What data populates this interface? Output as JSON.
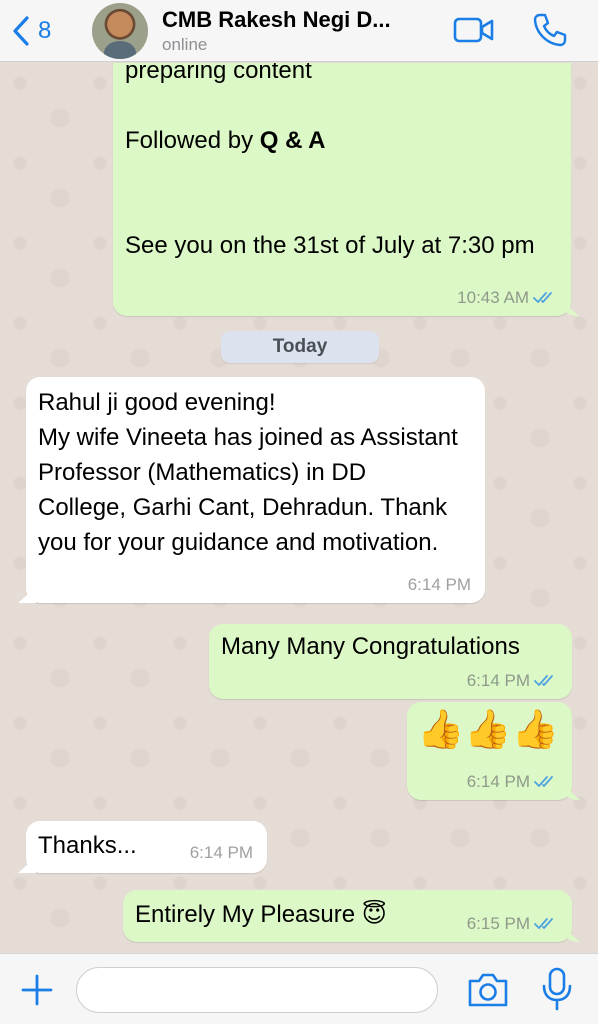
{
  "header": {
    "back_count": "8",
    "contact_name": "CMB Rakesh Negi D...",
    "status": "online",
    "icons": [
      "chevron-left-icon",
      "video-call-icon",
      "phone-icon"
    ],
    "accent_color": "#1a7ee6"
  },
  "messages": [
    {
      "direction": "out",
      "line1": "preparing content",
      "line2_prefix": "Followed by ",
      "line2_bold": "Q & A",
      "line3": "See you on the 31st of July at 7:30 pm",
      "time": "10:43 AM",
      "read": true
    },
    {
      "direction": "in",
      "text": "Rahul ji good evening!\nMy wife Vineeta has joined as Assistant Professor (Mathematics) in DD College, Garhi Cant, Dehradun. Thank you for your guidance and motivation.",
      "time": "6:14 PM"
    },
    {
      "direction": "out",
      "text": "Many Many Congratulations",
      "time": "6:14 PM",
      "read": true
    },
    {
      "direction": "out",
      "text": "👍👍👍",
      "time": "6:14 PM",
      "read": true
    },
    {
      "direction": "in",
      "text": "Thanks...",
      "time": "6:14 PM"
    },
    {
      "direction": "out",
      "text": "Entirely My Pleasure 😇",
      "time": "6:15 PM",
      "read": true
    }
  ],
  "date_divider": "Today",
  "composer": {
    "placeholder": "",
    "icons": [
      "plus-icon",
      "camera-icon",
      "microphone-icon"
    ]
  },
  "colors": {
    "outgoing_bubble": "#dcf8c6",
    "incoming_bubble": "#ffffff",
    "read_ticks": "#4fa3e0",
    "chat_background": "#e5ddd5"
  }
}
